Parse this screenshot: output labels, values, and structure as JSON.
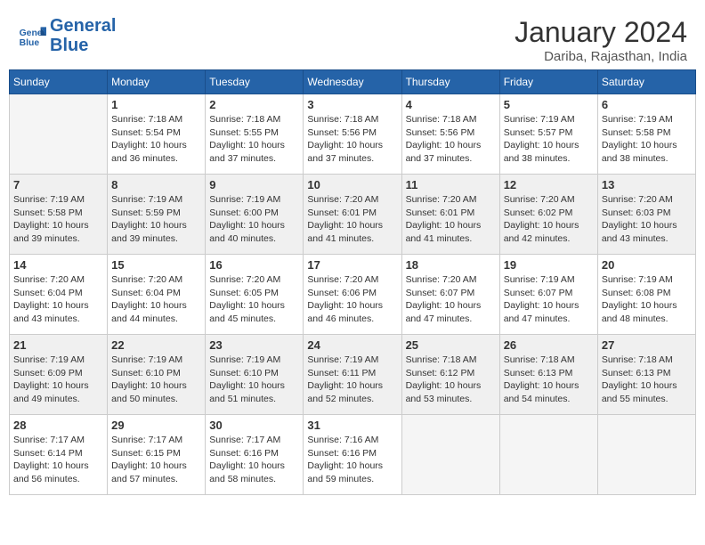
{
  "header": {
    "logo_line1": "General",
    "logo_line2": "Blue",
    "month": "January 2024",
    "location": "Dariba, Rajasthan, India"
  },
  "days_of_week": [
    "Sunday",
    "Monday",
    "Tuesday",
    "Wednesday",
    "Thursday",
    "Friday",
    "Saturday"
  ],
  "weeks": [
    [
      {
        "day": "",
        "info": ""
      },
      {
        "day": "1",
        "info": "Sunrise: 7:18 AM\nSunset: 5:54 PM\nDaylight: 10 hours\nand 36 minutes."
      },
      {
        "day": "2",
        "info": "Sunrise: 7:18 AM\nSunset: 5:55 PM\nDaylight: 10 hours\nand 37 minutes."
      },
      {
        "day": "3",
        "info": "Sunrise: 7:18 AM\nSunset: 5:56 PM\nDaylight: 10 hours\nand 37 minutes."
      },
      {
        "day": "4",
        "info": "Sunrise: 7:18 AM\nSunset: 5:56 PM\nDaylight: 10 hours\nand 37 minutes."
      },
      {
        "day": "5",
        "info": "Sunrise: 7:19 AM\nSunset: 5:57 PM\nDaylight: 10 hours\nand 38 minutes."
      },
      {
        "day": "6",
        "info": "Sunrise: 7:19 AM\nSunset: 5:58 PM\nDaylight: 10 hours\nand 38 minutes."
      }
    ],
    [
      {
        "day": "7",
        "info": "Sunrise: 7:19 AM\nSunset: 5:58 PM\nDaylight: 10 hours\nand 39 minutes."
      },
      {
        "day": "8",
        "info": "Sunrise: 7:19 AM\nSunset: 5:59 PM\nDaylight: 10 hours\nand 39 minutes."
      },
      {
        "day": "9",
        "info": "Sunrise: 7:19 AM\nSunset: 6:00 PM\nDaylight: 10 hours\nand 40 minutes."
      },
      {
        "day": "10",
        "info": "Sunrise: 7:20 AM\nSunset: 6:01 PM\nDaylight: 10 hours\nand 41 minutes."
      },
      {
        "day": "11",
        "info": "Sunrise: 7:20 AM\nSunset: 6:01 PM\nDaylight: 10 hours\nand 41 minutes."
      },
      {
        "day": "12",
        "info": "Sunrise: 7:20 AM\nSunset: 6:02 PM\nDaylight: 10 hours\nand 42 minutes."
      },
      {
        "day": "13",
        "info": "Sunrise: 7:20 AM\nSunset: 6:03 PM\nDaylight: 10 hours\nand 43 minutes."
      }
    ],
    [
      {
        "day": "14",
        "info": "Sunrise: 7:20 AM\nSunset: 6:04 PM\nDaylight: 10 hours\nand 43 minutes."
      },
      {
        "day": "15",
        "info": "Sunrise: 7:20 AM\nSunset: 6:04 PM\nDaylight: 10 hours\nand 44 minutes."
      },
      {
        "day": "16",
        "info": "Sunrise: 7:20 AM\nSunset: 6:05 PM\nDaylight: 10 hours\nand 45 minutes."
      },
      {
        "day": "17",
        "info": "Sunrise: 7:20 AM\nSunset: 6:06 PM\nDaylight: 10 hours\nand 46 minutes."
      },
      {
        "day": "18",
        "info": "Sunrise: 7:20 AM\nSunset: 6:07 PM\nDaylight: 10 hours\nand 47 minutes."
      },
      {
        "day": "19",
        "info": "Sunrise: 7:19 AM\nSunset: 6:07 PM\nDaylight: 10 hours\nand 47 minutes."
      },
      {
        "day": "20",
        "info": "Sunrise: 7:19 AM\nSunset: 6:08 PM\nDaylight: 10 hours\nand 48 minutes."
      }
    ],
    [
      {
        "day": "21",
        "info": "Sunrise: 7:19 AM\nSunset: 6:09 PM\nDaylight: 10 hours\nand 49 minutes."
      },
      {
        "day": "22",
        "info": "Sunrise: 7:19 AM\nSunset: 6:10 PM\nDaylight: 10 hours\nand 50 minutes."
      },
      {
        "day": "23",
        "info": "Sunrise: 7:19 AM\nSunset: 6:10 PM\nDaylight: 10 hours\nand 51 minutes."
      },
      {
        "day": "24",
        "info": "Sunrise: 7:19 AM\nSunset: 6:11 PM\nDaylight: 10 hours\nand 52 minutes."
      },
      {
        "day": "25",
        "info": "Sunrise: 7:18 AM\nSunset: 6:12 PM\nDaylight: 10 hours\nand 53 minutes."
      },
      {
        "day": "26",
        "info": "Sunrise: 7:18 AM\nSunset: 6:13 PM\nDaylight: 10 hours\nand 54 minutes."
      },
      {
        "day": "27",
        "info": "Sunrise: 7:18 AM\nSunset: 6:13 PM\nDaylight: 10 hours\nand 55 minutes."
      }
    ],
    [
      {
        "day": "28",
        "info": "Sunrise: 7:17 AM\nSunset: 6:14 PM\nDaylight: 10 hours\nand 56 minutes."
      },
      {
        "day": "29",
        "info": "Sunrise: 7:17 AM\nSunset: 6:15 PM\nDaylight: 10 hours\nand 57 minutes."
      },
      {
        "day": "30",
        "info": "Sunrise: 7:17 AM\nSunset: 6:16 PM\nDaylight: 10 hours\nand 58 minutes."
      },
      {
        "day": "31",
        "info": "Sunrise: 7:16 AM\nSunset: 6:16 PM\nDaylight: 10 hours\nand 59 minutes."
      },
      {
        "day": "",
        "info": ""
      },
      {
        "day": "",
        "info": ""
      },
      {
        "day": "",
        "info": ""
      }
    ]
  ]
}
